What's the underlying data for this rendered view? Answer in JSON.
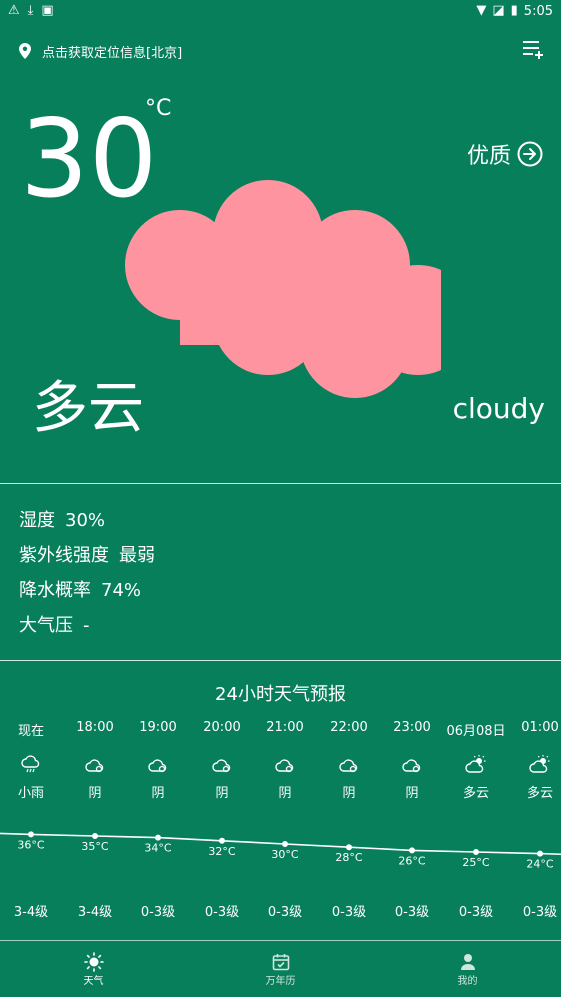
{
  "status_bar": {
    "time": "5:05"
  },
  "location": {
    "text": "点击获取定位信息[北京]",
    "icon": "location-pin-icon"
  },
  "current": {
    "temperature": "30",
    "unit": "°C",
    "air_quality": "优质",
    "condition_cn": "多云",
    "condition_en": "cloudy",
    "cloud_color": "#ff94a1"
  },
  "details": {
    "humidity_label": "湿度",
    "humidity_value": "30%",
    "uv_label": "紫外线强度",
    "uv_value": "最弱",
    "precip_label": "降水概率",
    "precip_value": "74%",
    "pressure_label": "大气压",
    "pressure_value": "-"
  },
  "forecast": {
    "title": "24小时天气预报",
    "hours": [
      {
        "time": "现在",
        "cond": "小雨",
        "icon": "rain-cloud-icon",
        "temp": "36°C",
        "wind": "3-4级"
      },
      {
        "time": "18:00",
        "cond": "阴",
        "icon": "overcast-cloud-icon",
        "temp": "35°C",
        "wind": "3-4级"
      },
      {
        "time": "19:00",
        "cond": "阴",
        "icon": "overcast-cloud-icon",
        "temp": "34°C",
        "wind": "0-3级"
      },
      {
        "time": "20:00",
        "cond": "阴",
        "icon": "overcast-cloud-icon",
        "temp": "32°C",
        "wind": "0-3级"
      },
      {
        "time": "21:00",
        "cond": "阴",
        "icon": "overcast-cloud-icon",
        "temp": "30°C",
        "wind": "0-3级"
      },
      {
        "time": "22:00",
        "cond": "阴",
        "icon": "overcast-cloud-icon",
        "temp": "28°C",
        "wind": "0-3级"
      },
      {
        "time": "23:00",
        "cond": "阴",
        "icon": "overcast-cloud-icon",
        "temp": "26°C",
        "wind": "0-3级"
      },
      {
        "time": "06月08日",
        "cond": "多云",
        "icon": "partly-cloudy-icon",
        "temp": "25°C",
        "wind": "0-3级"
      },
      {
        "time": "01:00",
        "cond": "多云",
        "icon": "partly-cloudy-icon",
        "temp": "24°C",
        "wind": "0-3级"
      }
    ],
    "temps": [
      36,
      35,
      34,
      32,
      30,
      28,
      26,
      25,
      24
    ]
  },
  "nav": {
    "weather_label": "天气",
    "calendar_label": "万年历",
    "profile_label": "我的"
  }
}
